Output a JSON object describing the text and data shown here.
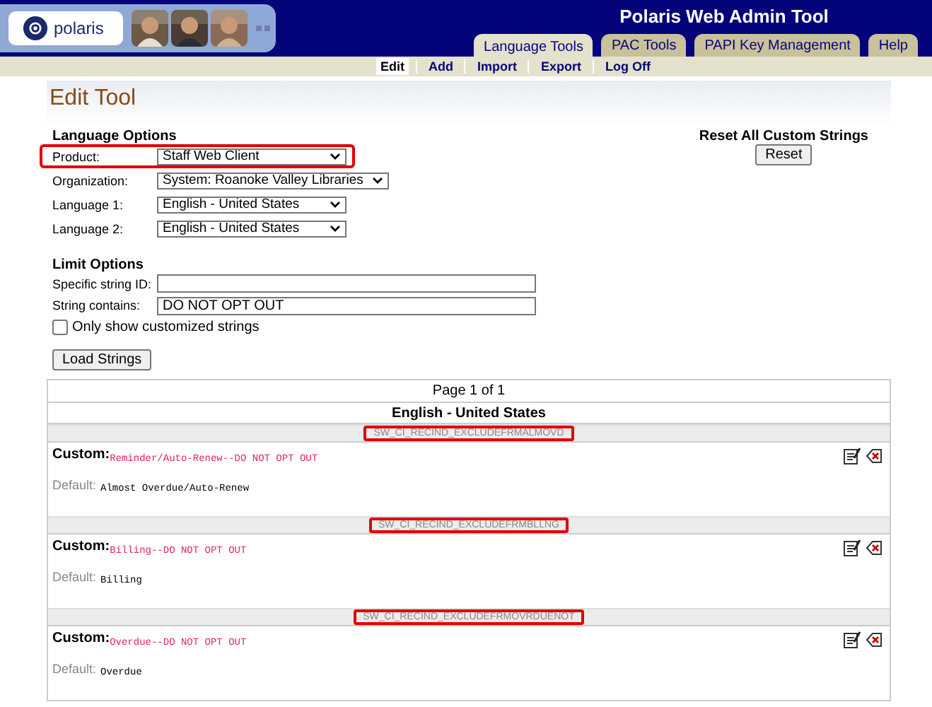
{
  "header": {
    "logo": "polaris",
    "title": "Polaris Web Admin Tool",
    "tabs": [
      {
        "label": "Language Tools",
        "selected": true
      },
      {
        "label": "PAC Tools",
        "selected": false
      },
      {
        "label": "PAPI Key Management",
        "selected": false
      },
      {
        "label": "Help",
        "selected": false
      }
    ]
  },
  "subnav": [
    {
      "label": "Edit",
      "selected": true
    },
    {
      "label": "Add",
      "selected": false
    },
    {
      "label": "Import",
      "selected": false
    },
    {
      "label": "Export",
      "selected": false
    },
    {
      "label": "Log Off",
      "selected": false
    }
  ],
  "page_title": "Edit Tool",
  "language_options": {
    "heading": "Language Options",
    "fields": [
      {
        "label": "Product:",
        "value": "Staff Web Client",
        "highlighted": true
      },
      {
        "label": "Organization:",
        "value": "System: Roanoke Valley Libraries",
        "highlighted": false
      },
      {
        "label": "Language 1:",
        "value": "English - United States",
        "highlighted": false
      },
      {
        "label": "Language 2:",
        "value": "English - United States",
        "highlighted": false
      }
    ]
  },
  "reset": {
    "heading": "Reset All Custom Strings",
    "button": "Reset"
  },
  "limit_options": {
    "heading": "Limit Options",
    "fields": [
      {
        "label": "Specific string ID:"
      },
      {
        "label": "String contains:",
        "value": "DO NOT OPT OUT"
      }
    ],
    "checkbox": {
      "label": "Only show customized strings",
      "checked": false
    },
    "button": "Load Strings"
  },
  "results": {
    "pager": "Page 1 of 1",
    "language": "English - United States",
    "entries": [
      {
        "id": "SW_CI_RECIND_EXCLUDEFRMALMOVD",
        "highlighted": true,
        "custom_label": "Custom:",
        "custom": "Reminder/Auto-Renew--DO NOT OPT OUT",
        "default_label": "Default:",
        "default": "Almost Overdue/Auto-Renew"
      },
      {
        "id": "SW_CI_RECIND_EXCLUDEFRMBLLNG",
        "highlighted": true,
        "custom_label": "Custom:",
        "custom": "Billing--DO NOT OPT OUT",
        "default_label": "Default:",
        "default": "Billing"
      },
      {
        "id": "SW_CI_RECIND_EXCLUDEFRMOVRDUENOT",
        "highlighted": true,
        "custom_label": "Custom:",
        "custom": "Overdue--DO NOT OPT OUT",
        "default_label": "Default:",
        "default": "Overdue"
      }
    ]
  }
}
